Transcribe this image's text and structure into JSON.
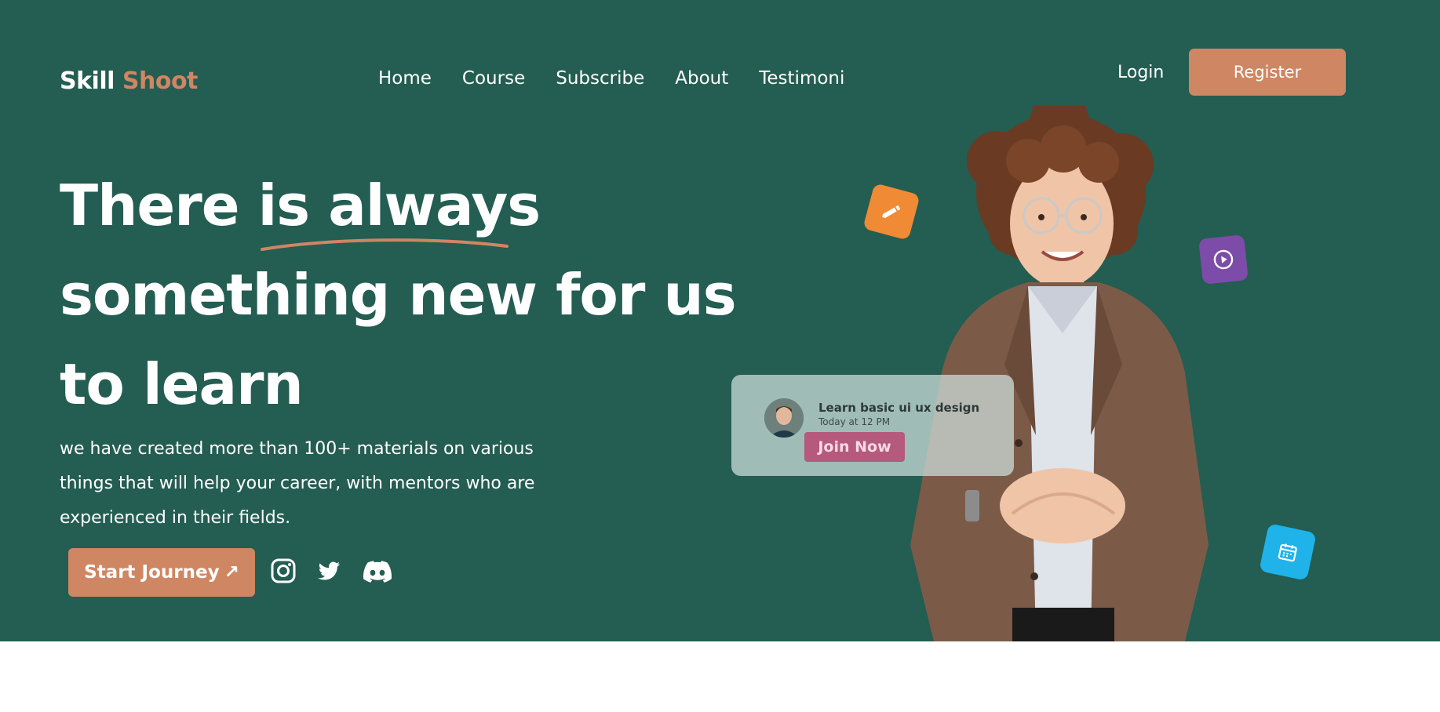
{
  "header": {
    "logo_primary": "Skill",
    "logo_accent": "Shoot",
    "nav": [
      "Home",
      "Course",
      "Subscribe",
      "About",
      "Testimoni"
    ],
    "login_label": "Login",
    "register_label": "Register"
  },
  "hero": {
    "headline_line1": "There is always",
    "headline_line2": "something new for us",
    "headline_line3": "to learn",
    "description": "we have created more than 100+ materials on various things that will help your career, with mentors who are experienced in their fields.",
    "cta_label": "Start Journey",
    "cta_icon": "↗",
    "social_icons": [
      "instagram-icon",
      "twitter-icon",
      "discord-icon"
    ]
  },
  "class_card": {
    "title": "Learn basic ui ux design",
    "time": "Today at 12 PM",
    "join_label": "Join Now"
  },
  "floating_icons": [
    "pencil-icon",
    "play-icon",
    "calendar-icon"
  ],
  "colors": {
    "hero_bg": "#245d52",
    "accent": "#cf8662",
    "tile_orange": "#f08a35",
    "tile_purple": "#7d4ca8",
    "tile_blue": "#1fb3ea",
    "join_button": "#b55a7c"
  }
}
